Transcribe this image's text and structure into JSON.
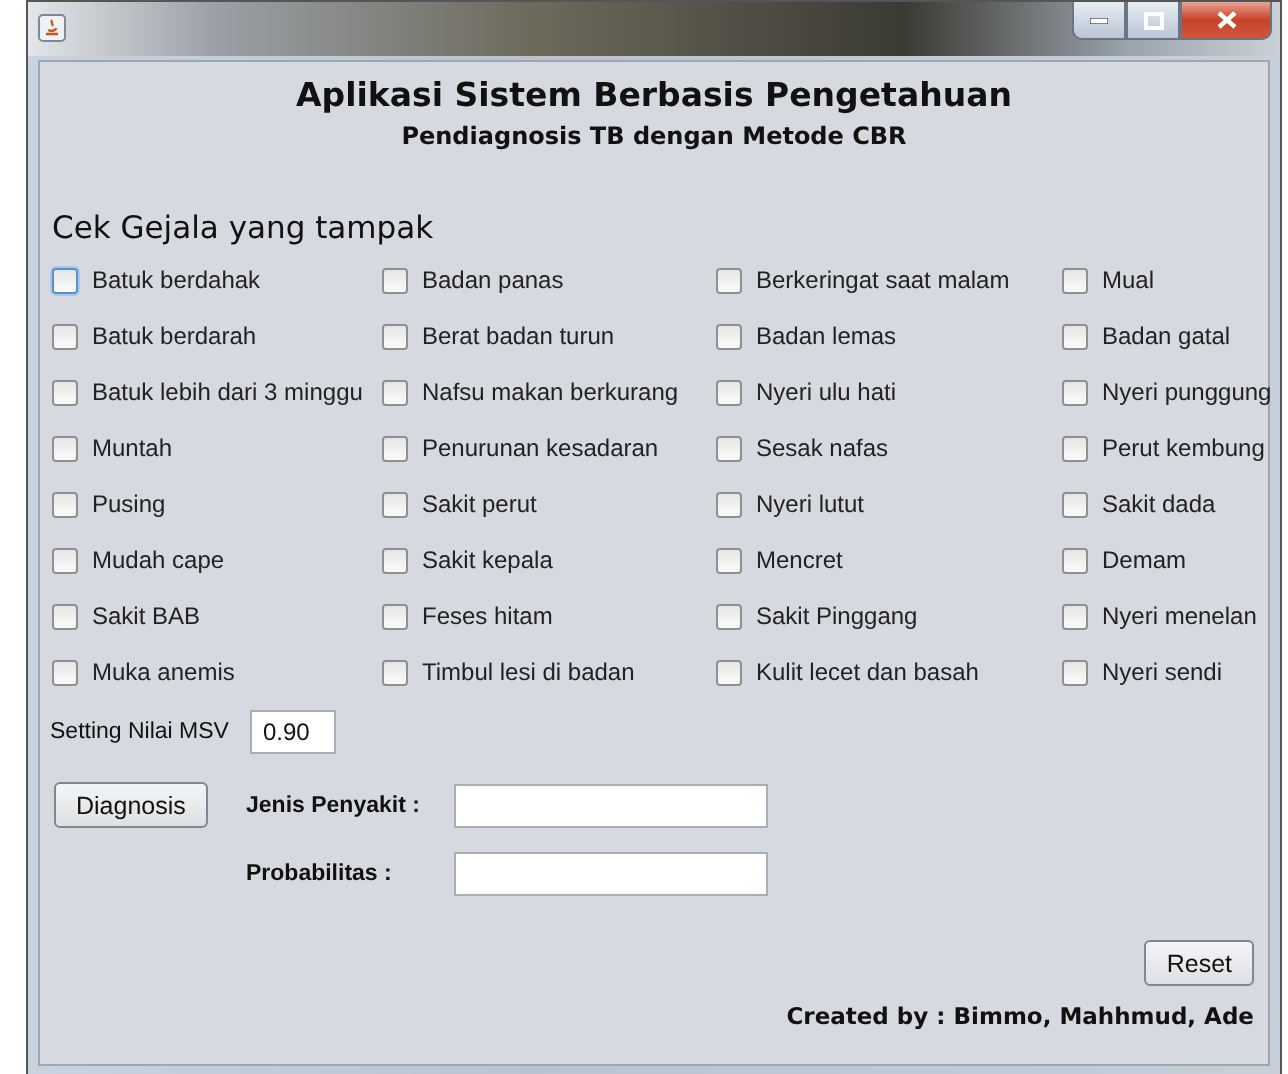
{
  "header": {
    "title": "Aplikasi Sistem Berbasis Pengetahuan",
    "subtitle": "Pendiagnosis TB dengan Metode CBR"
  },
  "symptoms_label": "Cek Gejala yang tampak",
  "symptoms": [
    {
      "label": "Batuk berdahak",
      "checked": false,
      "focused": true
    },
    {
      "label": "Badan panas",
      "checked": false,
      "focused": false
    },
    {
      "label": "Berkeringat saat malam",
      "checked": false,
      "focused": false
    },
    {
      "label": "Mual",
      "checked": false,
      "focused": false
    },
    {
      "label": "Batuk berdarah",
      "checked": false,
      "focused": false
    },
    {
      "label": "Berat badan turun",
      "checked": false,
      "focused": false
    },
    {
      "label": "Badan lemas",
      "checked": false,
      "focused": false
    },
    {
      "label": "Badan gatal",
      "checked": false,
      "focused": false
    },
    {
      "label": "Batuk lebih dari 3 minggu",
      "checked": false,
      "focused": false
    },
    {
      "label": "Nafsu makan berkurang",
      "checked": false,
      "focused": false
    },
    {
      "label": "Nyeri ulu hati",
      "checked": false,
      "focused": false
    },
    {
      "label": "Nyeri punggung",
      "checked": false,
      "focused": false
    },
    {
      "label": "Muntah",
      "checked": false,
      "focused": false
    },
    {
      "label": "Penurunan kesadaran",
      "checked": false,
      "focused": false
    },
    {
      "label": "Sesak nafas",
      "checked": false,
      "focused": false
    },
    {
      "label": "Perut kembung",
      "checked": false,
      "focused": false
    },
    {
      "label": "Pusing",
      "checked": false,
      "focused": false
    },
    {
      "label": "Sakit perut",
      "checked": false,
      "focused": false
    },
    {
      "label": "Nyeri lutut",
      "checked": false,
      "focused": false
    },
    {
      "label": "Sakit dada",
      "checked": false,
      "focused": false
    },
    {
      "label": "Mudah cape",
      "checked": false,
      "focused": false
    },
    {
      "label": "Sakit kepala",
      "checked": false,
      "focused": false
    },
    {
      "label": "Mencret",
      "checked": false,
      "focused": false
    },
    {
      "label": "Demam",
      "checked": false,
      "focused": false
    },
    {
      "label": "Sakit BAB",
      "checked": false,
      "focused": false
    },
    {
      "label": "Feses hitam",
      "checked": false,
      "focused": false
    },
    {
      "label": "Sakit Pinggang",
      "checked": false,
      "focused": false
    },
    {
      "label": "Nyeri menelan",
      "checked": false,
      "focused": false
    },
    {
      "label": "Muka anemis",
      "checked": false,
      "focused": false
    },
    {
      "label": "Timbul lesi di badan",
      "checked": false,
      "focused": false
    },
    {
      "label": "Kulit lecet dan basah",
      "checked": false,
      "focused": false
    },
    {
      "label": "Nyeri sendi",
      "checked": false,
      "focused": false
    }
  ],
  "msv": {
    "label": "Setting Nilai MSV",
    "value": "0.90"
  },
  "diagnosis_button": "Diagnosis",
  "results": [
    {
      "label": "Jenis Penyakit :"
    },
    {
      "label": "Probabilitas :"
    }
  ],
  "reset_button": "Reset",
  "credit": "Created by : Bimmo, Mahhmud, Ade"
}
